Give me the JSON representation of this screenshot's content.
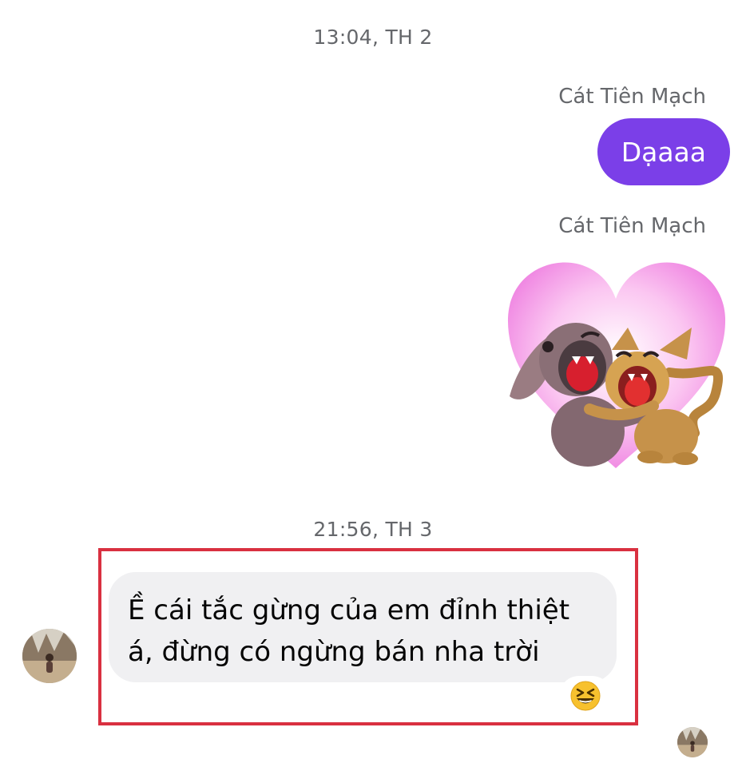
{
  "timestamps": [
    "13:04, TH 2",
    "21:56, TH 3"
  ],
  "outgoing": {
    "sender_name": "Cát Tiên Mạch",
    "message_text": "Dạaaa",
    "sticker_sender_name": "Cát Tiên Mạch",
    "sticker_icon": "dog-and-cat-hug-heart-sticker",
    "bubble_color": "#7b3fe8"
  },
  "incoming": {
    "message_line1": "Ề cái tắc gừng của em đỉnh thiệt",
    "message_line2": "á, đừng có ngừng bán nha trời",
    "reaction_icon": "laughing-emoji-icon",
    "avatar_icon": "user-avatar",
    "bubble_color": "#f0f0f2"
  },
  "highlight_color": "#d93040"
}
